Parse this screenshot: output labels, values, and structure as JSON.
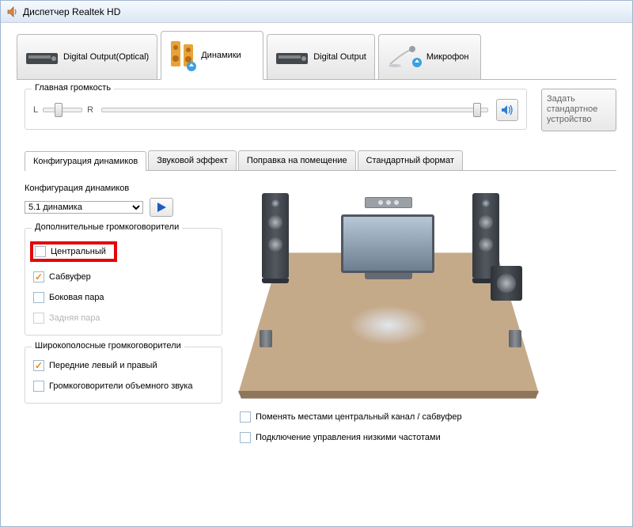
{
  "window": {
    "title": "Диспетчер Realtek HD"
  },
  "drivers": {
    "0": {
      "label": "Digital Output(Optical)"
    },
    "1": {
      "label": "Динамики"
    },
    "2": {
      "label": "Digital Output"
    },
    "3": {
      "label": "Микрофон"
    }
  },
  "volume": {
    "legend": "Главная громкость",
    "left_letter": "L",
    "right_letter": "R"
  },
  "default_device_btn": "Задать стандартное устройство",
  "subtabs": {
    "0": "Конфигурация динамиков",
    "1": "Звуковой эффект",
    "2": "Поправка на помещение",
    "3": "Стандартный формат"
  },
  "config": {
    "label": "Конфигурация динамиков",
    "selected": "5.1 динамика"
  },
  "optional": {
    "legend": "Дополнительные громкоговорители",
    "items": {
      "0": {
        "label": "Центральный"
      },
      "1": {
        "label": "Сабвуфер"
      },
      "2": {
        "label": "Боковая пара"
      },
      "3": {
        "label": "Задняя пара"
      }
    }
  },
  "fullrange": {
    "legend": "Широкополосные громкоговорители",
    "items": {
      "0": {
        "label": "Передние левый и правый"
      },
      "1": {
        "label": "Громкоговорители объемного звука"
      }
    }
  },
  "swap_check": "Поменять местами центральный канал / сабвуфер",
  "bass_check": "Подключение управления низкими частотами"
}
